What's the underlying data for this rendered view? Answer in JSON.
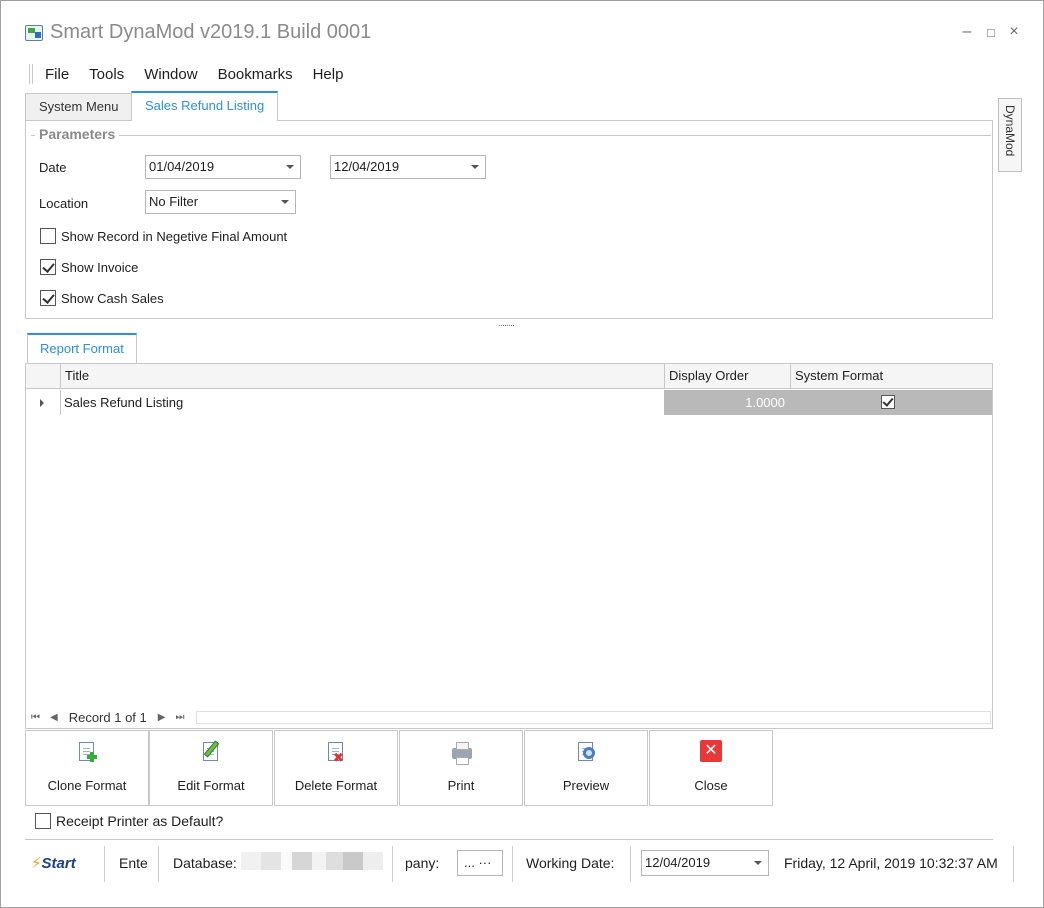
{
  "window": {
    "title": "Smart DynaMod v2019.1 Build 0001",
    "controls": {
      "minimize": "–",
      "maximize": "□",
      "close": "×"
    }
  },
  "menu": [
    "File",
    "Tools",
    "Window",
    "Bookmarks",
    "Help"
  ],
  "tabs": [
    {
      "label": "System Menu",
      "active": false
    },
    {
      "label": "Sales Refund Listing",
      "active": true
    }
  ],
  "side_tab": "DynaMod",
  "parameters": {
    "group_title": "Parameters",
    "date_label": "Date",
    "date_from": "01/04/2019",
    "date_to": "12/04/2019",
    "location_label": "Location",
    "location_value": "No Filter",
    "checkboxes": [
      {
        "label": "Show Record in Negetive Final Amount",
        "checked": false
      },
      {
        "label": "Show Invoice",
        "checked": true
      },
      {
        "label": "Show Cash Sales",
        "checked": true
      }
    ]
  },
  "report_format": {
    "tab_label": "Report Format",
    "columns": [
      "Title",
      "Display Order",
      "System Format"
    ],
    "rows": [
      {
        "title": "Sales Refund Listing",
        "display_order": "1.0000",
        "system_format": true
      }
    ],
    "navigator": {
      "record_text": "Record 1 of 1"
    }
  },
  "actions": [
    "Clone Format",
    "Edit Format",
    "Delete Format",
    "Print",
    "Preview",
    "Close"
  ],
  "receipt_printer": {
    "label": "Receipt Printer as Default?",
    "checked": false
  },
  "statusbar": {
    "logo": "Start",
    "ente": "Ente",
    "database_label": "Database:",
    "company_label": "pany:",
    "company_value": "... ···",
    "working_date_label": "Working Date:",
    "working_date": "12/04/2019",
    "datetime": "Friday, 12 April, 2019 10:32:37 AM"
  },
  "colors": {
    "accent": "#2e8fdc",
    "grid_highlight": "#b9b9b9",
    "close_red": "#e8383a"
  }
}
